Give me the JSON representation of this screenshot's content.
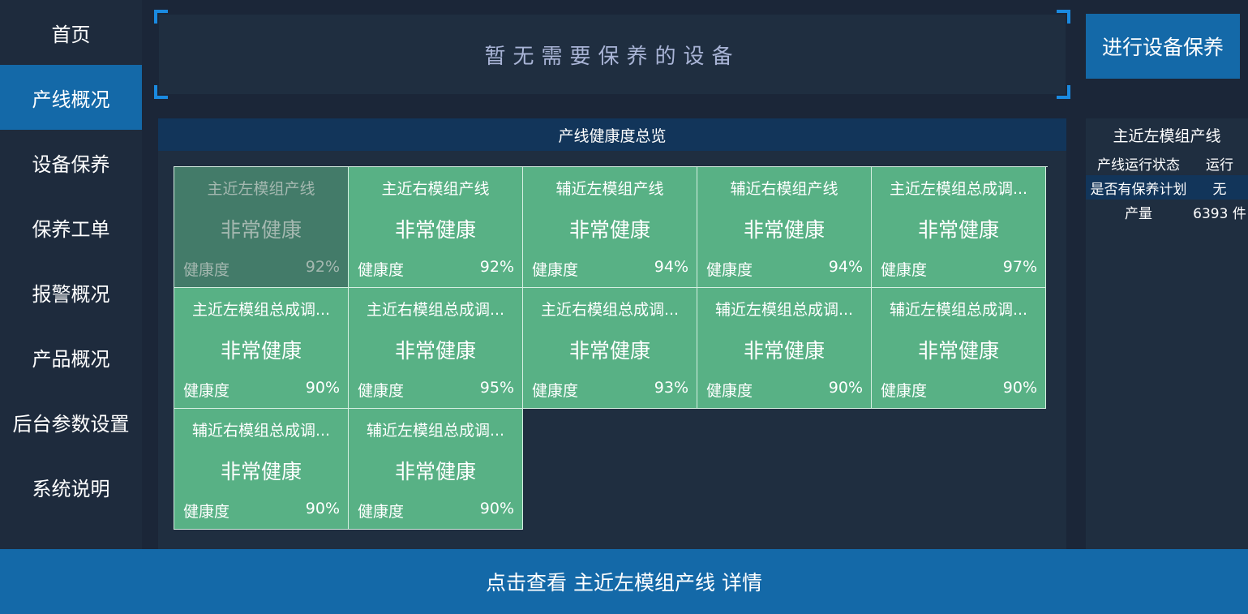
{
  "sidebar": {
    "items": [
      {
        "label": "首页",
        "active": false
      },
      {
        "label": "产线概况",
        "active": true
      },
      {
        "label": "设备保养",
        "active": false
      },
      {
        "label": "保养工单",
        "active": false
      },
      {
        "label": "报警概况",
        "active": false
      },
      {
        "label": "产品概况",
        "active": false
      },
      {
        "label": "后台参数设置",
        "active": false
      },
      {
        "label": "系统说明",
        "active": false
      }
    ]
  },
  "notice": {
    "text": "暂无需要保养的设备"
  },
  "maintenance_button": {
    "label": "进行设备保养"
  },
  "overview": {
    "title": "产线健康度总览",
    "health_label": "健康度",
    "lines": [
      {
        "name": "主近左模组产线",
        "status": "非常健康",
        "health": "92%",
        "selected": true
      },
      {
        "name": "主近右模组产线",
        "status": "非常健康",
        "health": "92%"
      },
      {
        "name": "辅近左模组产线",
        "status": "非常健康",
        "health": "94%"
      },
      {
        "name": "辅近右模组产线",
        "status": "非常健康",
        "health": "94%"
      },
      {
        "name": "主近左模组总成调...",
        "status": "非常健康",
        "health": "97%"
      },
      {
        "name": "主近左模组总成调...",
        "status": "非常健康",
        "health": "90%"
      },
      {
        "name": "主近右模组总成调...",
        "status": "非常健康",
        "health": "95%"
      },
      {
        "name": "主近右模组总成调...",
        "status": "非常健康",
        "health": "93%"
      },
      {
        "name": "辅近左模组总成调...",
        "status": "非常健康",
        "health": "90%"
      },
      {
        "name": "辅近左模组总成调...",
        "status": "非常健康",
        "health": "90%"
      },
      {
        "name": "辅近右模组总成调...",
        "status": "非常健康",
        "health": "90%"
      },
      {
        "name": "辅近左模组总成调...",
        "status": "非常健康",
        "health": "90%"
      }
    ]
  },
  "info_panel": {
    "title": "主近左模组产线",
    "rows": [
      {
        "key": "产线运行状态",
        "value": "运行"
      },
      {
        "key": "是否有保养计划",
        "value": "无"
      },
      {
        "key": "产量",
        "value": "6393 件"
      }
    ]
  },
  "footer": {
    "label": "点击查看 主近左模组产线 详情"
  },
  "colors": {
    "background": "#1b2638",
    "sidebar": "#1e2b3d",
    "accent_blue": "#1469a8",
    "tile_green": "#58b185",
    "tile_selected": "#437b69",
    "header_navy": "#12355a",
    "corner_bracket": "#1a8ae0"
  }
}
